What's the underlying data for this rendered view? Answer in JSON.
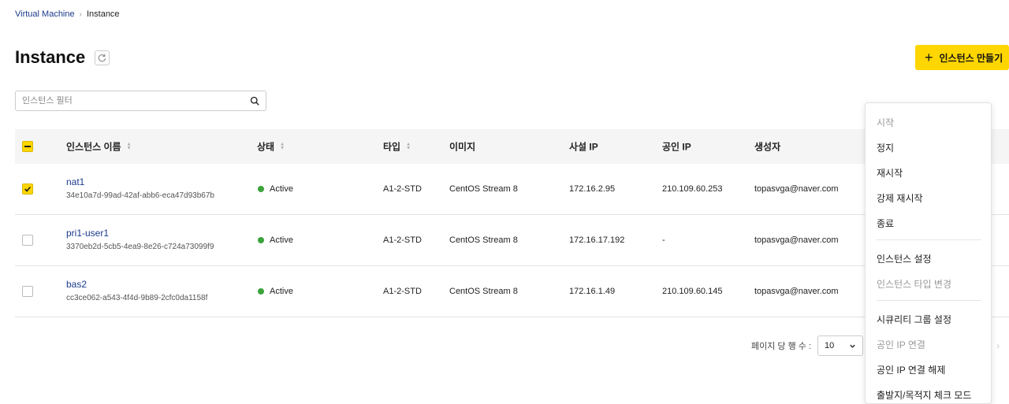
{
  "breadcrumb": {
    "parent": "Virtual Machine",
    "current": "Instance"
  },
  "page": {
    "title": "Instance"
  },
  "toolbar": {
    "create_label": "인스턴스 만들기"
  },
  "filter": {
    "placeholder": "인스턴스 필터"
  },
  "table": {
    "headers": {
      "name": "인스턴스 이름",
      "status": "상태",
      "type": "타입",
      "image": "이미지",
      "private_ip": "사설 IP",
      "public_ip": "공인 IP",
      "creator": "생성자"
    },
    "rows": [
      {
        "name": "nat1",
        "id": "34e10a7d-99ad-42af-abb6-eca47d93b67b",
        "status": "Active",
        "type": "A1-2-STD",
        "image": "CentOS Stream 8",
        "private_ip": "172.16.2.95",
        "public_ip": "210.109.60.253",
        "creator": "topasvga@naver.com",
        "checked": true
      },
      {
        "name": "pri1-user1",
        "id": "3370eb2d-5cb5-4ea9-8e26-c724a73099f9",
        "status": "Active",
        "type": "A1-2-STD",
        "image": "CentOS Stream 8",
        "private_ip": "172.16.17.192",
        "public_ip": "-",
        "creator": "topasvga@naver.com",
        "checked": false
      },
      {
        "name": "bas2",
        "id": "cc3ce062-a543-4f4d-9b89-2cfc0da1158f",
        "status": "Active",
        "type": "A1-2-STD",
        "image": "CentOS Stream 8",
        "private_ip": "172.16.1.49",
        "public_ip": "210.109.60.145",
        "creator": "topasvga@naver.com",
        "checked": false
      }
    ]
  },
  "menu": {
    "items": [
      {
        "label": "시작",
        "disabled": true
      },
      {
        "label": "정지",
        "disabled": false
      },
      {
        "label": "재시작",
        "disabled": false
      },
      {
        "label": "강제 재시작",
        "disabled": false
      },
      {
        "label": "종료",
        "disabled": false
      },
      {
        "label": "인스턴스 설정",
        "disabled": false
      },
      {
        "label": "인스턴스 타입 변경",
        "disabled": true
      },
      {
        "label": "시큐리티 그룹 설정",
        "disabled": false
      },
      {
        "label": "공인 IP 연결",
        "disabled": true
      },
      {
        "label": "공인 IP 연결 해제",
        "disabled": false
      },
      {
        "label": "출발지/목적지 체크 모드",
        "disabled": false
      }
    ]
  },
  "pager": {
    "label": "페이지 당 행 수 :",
    "rows_per_page": "10"
  },
  "colors": {
    "accent": "#ffd600",
    "link": "#1a3a8c",
    "active": "#3ba33b"
  }
}
